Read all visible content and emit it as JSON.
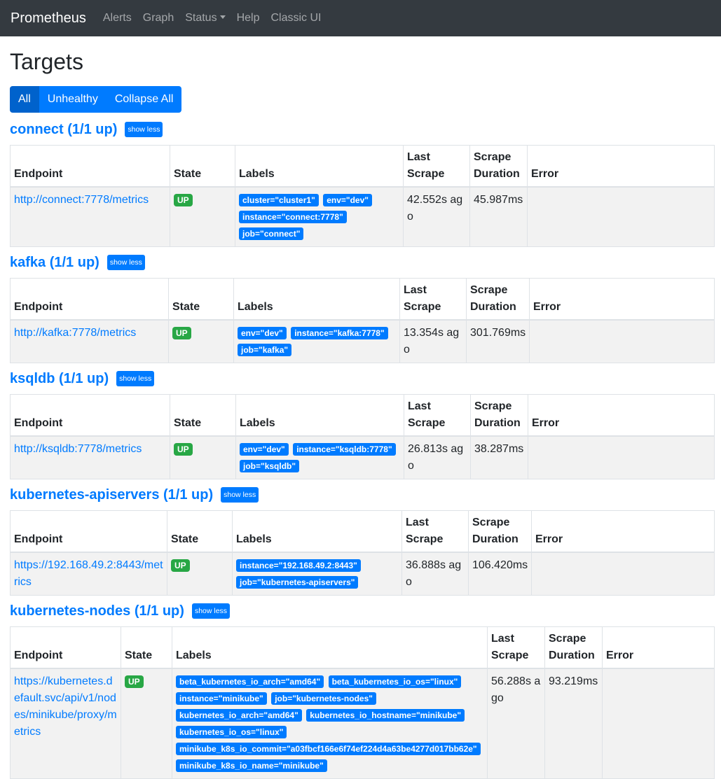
{
  "nav": {
    "brand": "Prometheus",
    "alerts": "Alerts",
    "graph": "Graph",
    "status": "Status",
    "help": "Help",
    "classic": "Classic UI"
  },
  "page_title": "Targets",
  "filters": {
    "all": "All",
    "unhealthy": "Unhealthy",
    "collapse": "Collapse All"
  },
  "show_less": "show less",
  "columns": {
    "endpoint": "Endpoint",
    "state": "State",
    "labels": "Labels",
    "last_scrape": "Last Scrape",
    "scrape_duration": "Scrape Duration",
    "error": "Error"
  },
  "pools": [
    {
      "title": "connect (1/1 up)",
      "endpoint": "http://connect:7778/metrics",
      "state": "UP",
      "labels": [
        "cluster=\"cluster1\"",
        "env=\"dev\"",
        "instance=\"connect:7778\"",
        "job=\"connect\""
      ],
      "last_scrape": "42.552s ago",
      "scrape_duration": "45.987ms",
      "error": ""
    },
    {
      "title": "kafka (1/1 up)",
      "endpoint": "http://kafka:7778/metrics",
      "state": "UP",
      "labels": [
        "env=\"dev\"",
        "instance=\"kafka:7778\"",
        "job=\"kafka\""
      ],
      "last_scrape": "13.354s ago",
      "scrape_duration": "301.769ms",
      "error": ""
    },
    {
      "title": "ksqldb (1/1 up)",
      "endpoint": "http://ksqldb:7778/metrics",
      "state": "UP",
      "labels": [
        "env=\"dev\"",
        "instance=\"ksqldb:7778\"",
        "job=\"ksqldb\""
      ],
      "last_scrape": "26.813s ago",
      "scrape_duration": "38.287ms",
      "error": ""
    },
    {
      "title": "kubernetes-apiservers (1/1 up)",
      "endpoint": "https://192.168.49.2:8443/metrics",
      "state": "UP",
      "labels": [
        "instance=\"192.168.49.2:8443\"",
        "job=\"kubernetes-apiservers\""
      ],
      "last_scrape": "36.888s ago",
      "scrape_duration": "106.420ms",
      "error": ""
    },
    {
      "title": "kubernetes-nodes (1/1 up)",
      "endpoint": "https://kubernetes.default.svc/api/v1/nodes/minikube/proxy/metrics",
      "state": "UP",
      "labels": [
        "beta_kubernetes_io_arch=\"amd64\"",
        "beta_kubernetes_io_os=\"linux\"",
        "instance=\"minikube\"",
        "job=\"kubernetes-nodes\"",
        "kubernetes_io_arch=\"amd64\"",
        "kubernetes_io_hostname=\"minikube\"",
        "kubernetes_io_os=\"linux\"",
        "minikube_k8s_io_commit=\"a03fbcf166e6f74ef224d4a63be4277d017bb62e\"",
        "minikube_k8s_io_name=\"minikube\""
      ],
      "last_scrape": "56.288s ago",
      "scrape_duration": "93.219ms",
      "error": ""
    }
  ]
}
